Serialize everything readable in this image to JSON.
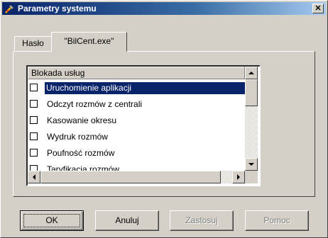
{
  "window": {
    "title": "Parametry systemu",
    "close_glyph": "✕",
    "icon": "tools-icon"
  },
  "tabs": [
    {
      "label": "Hasło",
      "active": false
    },
    {
      "label": "\"BilCent.exe\"",
      "active": true
    }
  ],
  "list": {
    "header": "Blokada usług",
    "items": [
      {
        "label": "Uruchomienie aplikacji",
        "checked": false,
        "selected": true
      },
      {
        "label": "Odczyt rozmów z centrali",
        "checked": false,
        "selected": false
      },
      {
        "label": "Kasowanie okresu",
        "checked": false,
        "selected": false
      },
      {
        "label": "Wydruk rozmów",
        "checked": false,
        "selected": false
      },
      {
        "label": "Poufność rozmów",
        "checked": false,
        "selected": false
      },
      {
        "label": "Taryfikacja rozmów",
        "checked": false,
        "selected": false
      }
    ]
  },
  "buttons": {
    "ok": "OK",
    "cancel": "Anuluj",
    "apply": "Zastosuj",
    "help": "Pomoc"
  },
  "colors": {
    "titlebar": "#0a246a",
    "selection": "#0a246a",
    "face": "#d4d0c8",
    "disabled_text": "#808080"
  }
}
